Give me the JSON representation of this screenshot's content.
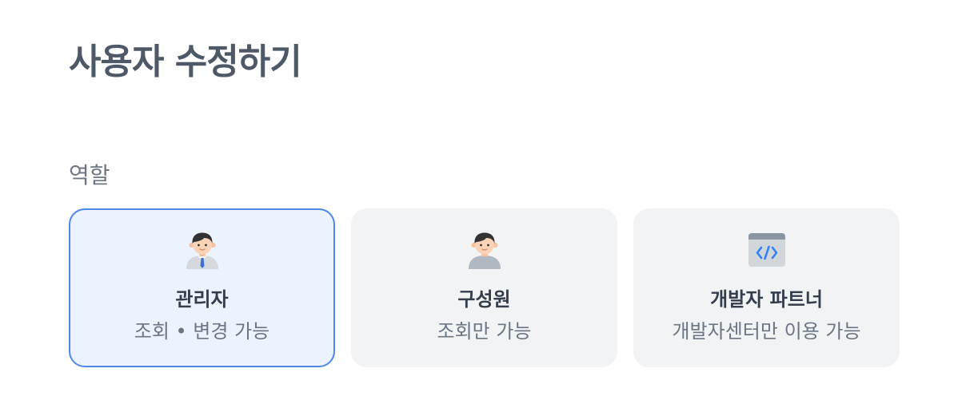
{
  "page": {
    "title": "사용자 수정하기"
  },
  "role_section": {
    "label": "역할",
    "options": [
      {
        "name": "관리자",
        "description": "조회 • 변경 가능",
        "icon": "admin-person-icon",
        "selected": true
      },
      {
        "name": "구성원",
        "description": "조회만 가능",
        "icon": "member-person-icon",
        "selected": false
      },
      {
        "name": "개발자 파트너",
        "description": "개발자센터만 이용 가능",
        "icon": "code-window-icon",
        "selected": false
      }
    ]
  },
  "colors": {
    "selected_border": "#4f86e8",
    "selected_background": "#ebf3fe",
    "card_background": "#f2f3f5",
    "title_text": "#4e5968",
    "secondary_text": "#6b7684"
  }
}
